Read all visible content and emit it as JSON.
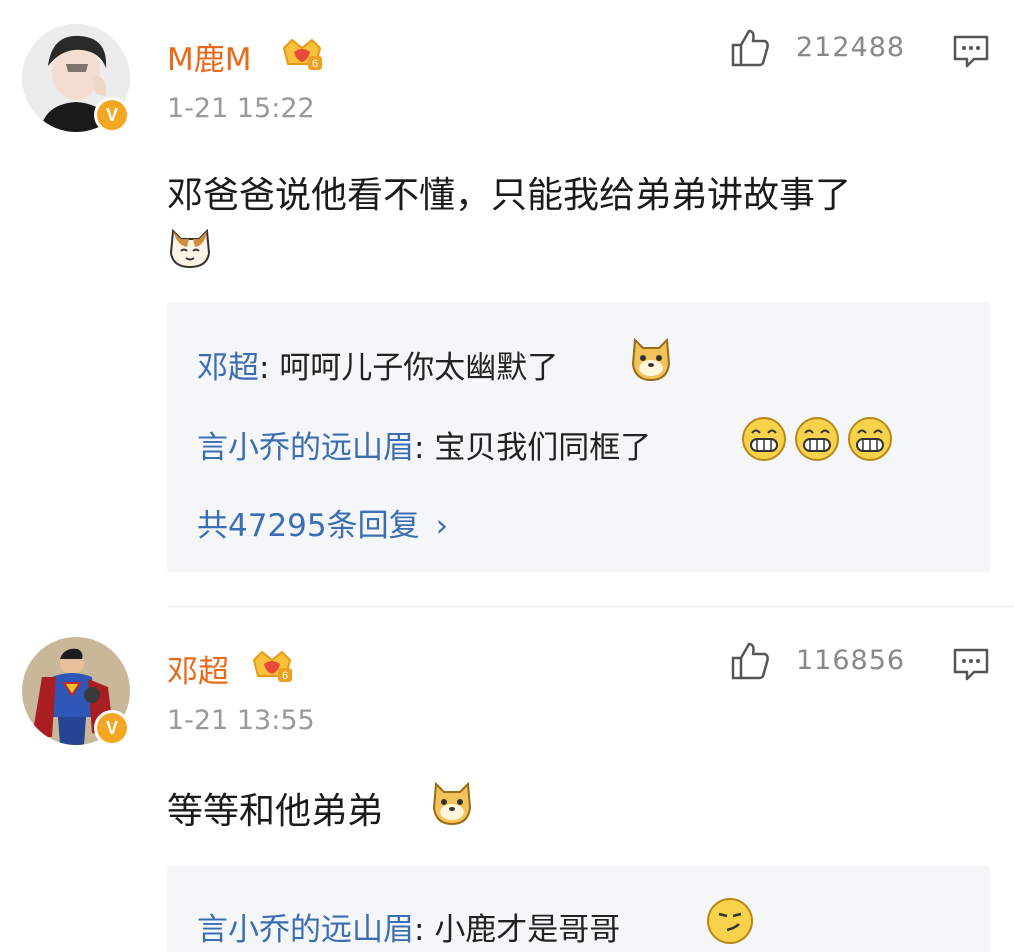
{
  "comments": [
    {
      "username": "M鹿M",
      "time": "1-21 15:22",
      "like_count": "212488",
      "text": "邓爸爸说他看不懂，只能我给弟弟讲故事了",
      "text_emoji": "cat-emoji",
      "badge_level": "6",
      "verified": "V",
      "replies": [
        {
          "name": "邓超",
          "sep": ": ",
          "text": "呵呵儿子你太幽默了",
          "emoji": "doge-emoji"
        },
        {
          "name": "言小乔的远山眉",
          "sep": ": ",
          "text": "宝贝我们同框了",
          "emoji": "grin-emoji x3"
        }
      ],
      "more_replies": "共47295条回复",
      "more_chevron": "›"
    },
    {
      "username": "邓超",
      "time": "1-21 13:55",
      "like_count": "116856",
      "text": "等等和他弟弟",
      "text_emoji": "doge-emoji",
      "badge_level": "6",
      "verified": "V",
      "replies": [
        {
          "name": "言小乔的远山眉",
          "sep": ": ",
          "text": "小鹿才是哥哥",
          "emoji": "smirk-emoji"
        }
      ]
    }
  ],
  "colors": {
    "username": "#e86a1a",
    "reply_name": "#3b6db3",
    "badge": "#f5a623",
    "reply_bg": "#f5f6f8"
  }
}
